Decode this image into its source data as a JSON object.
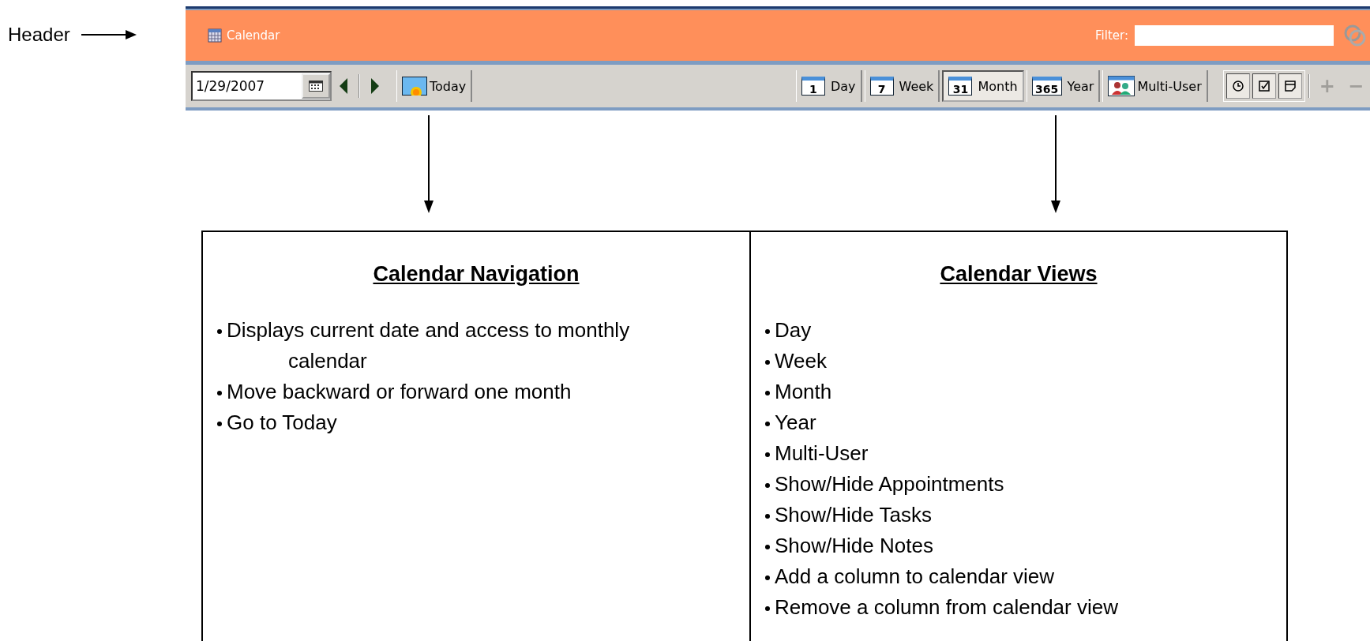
{
  "callout": {
    "label": "Header"
  },
  "app": {
    "title": "Calendar",
    "filter": {
      "label": "Filter:"
    },
    "date": {
      "value": "1/29/2007"
    },
    "today": "Today",
    "views": [
      {
        "label": "Day",
        "badge": "1",
        "selected": false
      },
      {
        "label": "Week",
        "badge": "7",
        "selected": false
      },
      {
        "label": "Month",
        "badge": "31",
        "selected": true
      },
      {
        "label": "Year",
        "badge": "365",
        "selected": false
      },
      {
        "label": "Multi-User",
        "selected": false
      }
    ],
    "toggles": [
      {
        "kind": "clock",
        "on": true
      },
      {
        "kind": "check",
        "on": true
      },
      {
        "kind": "note",
        "on": true
      }
    ],
    "columns": [
      {
        "label": "+",
        "disabled": true
      },
      {
        "label": "−",
        "disabled": true
      }
    ]
  },
  "table": [
    {
      "heading": "Calendar Navigation",
      "items": [
        {
          "text": "Displays current date and access to monthly",
          "cont": "calendar"
        },
        {
          "text": "Move backward or forward one month"
        },
        {
          "text": "Go to Today"
        }
      ]
    },
    {
      "heading": "Calendar Views",
      "items": [
        {
          "text": "Day"
        },
        {
          "text": "Week"
        },
        {
          "text": "Month"
        },
        {
          "text": "Year"
        },
        {
          "text": "Multi-User"
        },
        {
          "text": "Show/Hide Appointments"
        },
        {
          "text": "Show/Hide Tasks"
        },
        {
          "text": "Show/Hide Notes"
        },
        {
          "text": "Add a column to calendar view"
        },
        {
          "text": "Remove a column from calendar view"
        }
      ]
    }
  ]
}
